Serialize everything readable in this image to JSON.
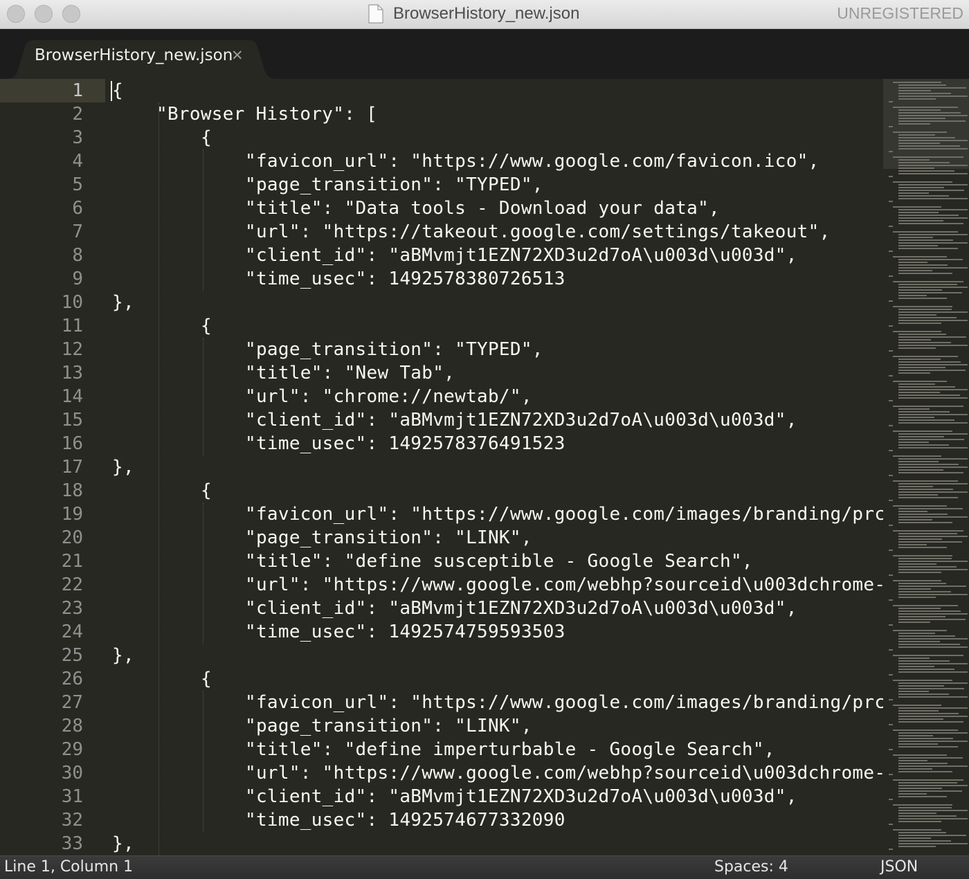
{
  "window": {
    "title": "BrowserHistory_new.json",
    "license": "UNREGISTERED",
    "file_icon": "document-icon",
    "close_icon": "close-icon"
  },
  "tabs": [
    {
      "label": "BrowserHistory_new.json",
      "close_glyph": "✕",
      "active": true
    }
  ],
  "editor": {
    "current_line": 1,
    "lines": [
      {
        "n": "1",
        "indent": 0,
        "text": "{"
      },
      {
        "n": "2",
        "indent": 1,
        "text": "\"Browser History\": ["
      },
      {
        "n": "3",
        "indent": 2,
        "text": "{"
      },
      {
        "n": "4",
        "indent": 3,
        "text": "\"favicon_url\": \"https://www.google.com/favicon.ico\","
      },
      {
        "n": "5",
        "indent": 3,
        "text": "\"page_transition\": \"TYPED\","
      },
      {
        "n": "6",
        "indent": 3,
        "text": "\"title\": \"Data tools - Download your data\","
      },
      {
        "n": "7",
        "indent": 3,
        "text": "\"url\": \"https://takeout.google.com/settings/takeout\","
      },
      {
        "n": "8",
        "indent": 3,
        "text": "\"client_id\": \"aBMvmjt1EZN72XD3u2d7oA\\u003d\\u003d\","
      },
      {
        "n": "9",
        "indent": 3,
        "text": "\"time_usec\": 1492578380726513"
      },
      {
        "n": "10",
        "indent": 0,
        "text": "},"
      },
      {
        "n": "11",
        "indent": 2,
        "text": "{"
      },
      {
        "n": "12",
        "indent": 3,
        "text": "\"page_transition\": \"TYPED\","
      },
      {
        "n": "13",
        "indent": 3,
        "text": "\"title\": \"New Tab\","
      },
      {
        "n": "14",
        "indent": 3,
        "text": "\"url\": \"chrome://newtab/\","
      },
      {
        "n": "15",
        "indent": 3,
        "text": "\"client_id\": \"aBMvmjt1EZN72XD3u2d7oA\\u003d\\u003d\","
      },
      {
        "n": "16",
        "indent": 3,
        "text": "\"time_usec\": 1492578376491523"
      },
      {
        "n": "17",
        "indent": 0,
        "text": "},"
      },
      {
        "n": "18",
        "indent": 2,
        "text": "{"
      },
      {
        "n": "19",
        "indent": 3,
        "text": "\"favicon_url\": \"https://www.google.com/images/branding/prc"
      },
      {
        "n": "20",
        "indent": 3,
        "text": "\"page_transition\": \"LINK\","
      },
      {
        "n": "21",
        "indent": 3,
        "text": "\"title\": \"define susceptible - Google Search\","
      },
      {
        "n": "22",
        "indent": 3,
        "text": "\"url\": \"https://www.google.com/webhp?sourceid\\u003dchrome-"
      },
      {
        "n": "23",
        "indent": 3,
        "text": "\"client_id\": \"aBMvmjt1EZN72XD3u2d7oA\\u003d\\u003d\","
      },
      {
        "n": "24",
        "indent": 3,
        "text": "\"time_usec\": 1492574759593503"
      },
      {
        "n": "25",
        "indent": 0,
        "text": "},"
      },
      {
        "n": "26",
        "indent": 2,
        "text": "{"
      },
      {
        "n": "27",
        "indent": 3,
        "text": "\"favicon_url\": \"https://www.google.com/images/branding/prc"
      },
      {
        "n": "28",
        "indent": 3,
        "text": "\"page_transition\": \"LINK\","
      },
      {
        "n": "29",
        "indent": 3,
        "text": "\"title\": \"define imperturbable - Google Search\","
      },
      {
        "n": "30",
        "indent": 3,
        "text": "\"url\": \"https://www.google.com/webhp?sourceid\\u003dchrome-"
      },
      {
        "n": "31",
        "indent": 3,
        "text": "\"client_id\": \"aBMvmjt1EZN72XD3u2d7oA\\u003d\\u003d\","
      },
      {
        "n": "32",
        "indent": 3,
        "text": "\"time_usec\": 1492574677332090"
      },
      {
        "n": "33",
        "indent": 0,
        "text": "},"
      }
    ]
  },
  "status": {
    "position": "Line 1, Column 1",
    "indentation": "Spaces: 4",
    "syntax": "JSON"
  },
  "colors": {
    "editor_bg": "#272822",
    "text": "#f8f8f2",
    "gutter_text": "#909090",
    "titlebar": "#dcdcdc",
    "tabstrip": "#1c1c1c"
  }
}
